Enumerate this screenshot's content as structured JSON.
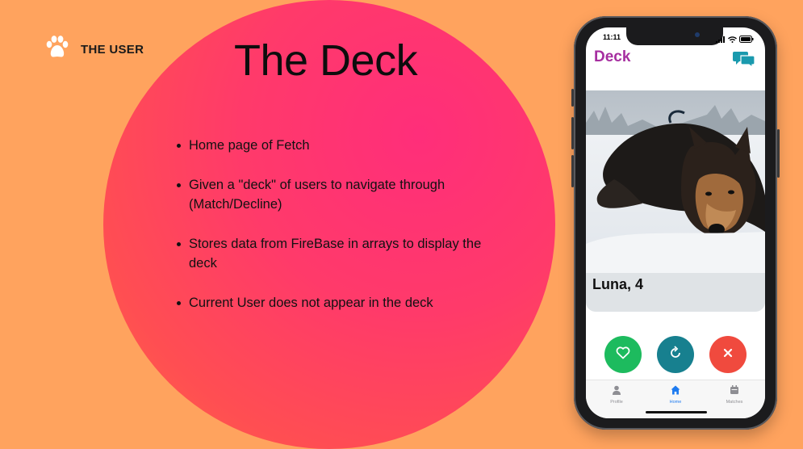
{
  "brand": {
    "name": "THE USER",
    "icon": "paw-icon"
  },
  "title": "The Deck",
  "bullets": [
    "Home page of Fetch",
    "Given a \"deck\" of users to navigate through (Match/Decline)",
    "Stores data from FireBase in arrays to display the deck",
    "Current User does not appear in the deck"
  ],
  "phone": {
    "status_time": "11:11",
    "app_title": "Deck",
    "card": {
      "name": "Luna, 4",
      "photo": "dog-in-snow-photo"
    },
    "actions": [
      {
        "name": "match",
        "icon": "heart-icon",
        "color": "#1DBB5E"
      },
      {
        "name": "refresh",
        "icon": "refresh-icon",
        "color": "#17808F"
      },
      {
        "name": "decline",
        "icon": "close-icon",
        "color": "#F04A3E"
      }
    ],
    "tabs": [
      {
        "label": "Profile",
        "icon": "person-icon",
        "active": false
      },
      {
        "label": "Home",
        "icon": "home-icon",
        "active": true
      },
      {
        "label": "Matches",
        "icon": "matches-icon",
        "active": false
      }
    ],
    "colors": {
      "title": "#A62FA0",
      "chat": "#1A9AAE",
      "tab_active": "#1E7BF0",
      "tab_inactive": "#8E8E93"
    }
  }
}
